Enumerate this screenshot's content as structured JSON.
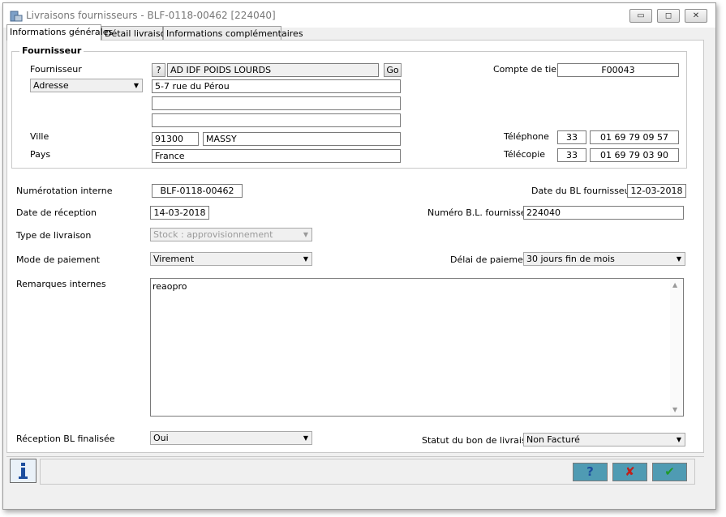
{
  "window": {
    "title": "Livraisons fournisseurs - BLF-0118-00462 [224040]",
    "controls": {
      "minimize": "▭",
      "maximize": "◻",
      "close": "✕"
    }
  },
  "tabs": [
    {
      "label": "Informations générales",
      "active": true
    },
    {
      "label": "Détail livraison",
      "active": false
    },
    {
      "label": "Informations complémentaires",
      "active": false
    }
  ],
  "supplier_group": {
    "title": "Fournisseur",
    "fournisseur_label": "Fournisseur",
    "lookup_button": "?",
    "fournisseur_value": "AD IDF POIDS LOURDS",
    "go_button": "Go",
    "adresse_select": "Adresse",
    "adresse_line1": "5-7 rue du Pérou",
    "adresse_line2": "",
    "adresse_line3": "",
    "ville_label": "Ville",
    "code_postal": "91300",
    "ville": "MASSY",
    "pays_label": "Pays",
    "pays": "France",
    "compte_tiers_label": "Compte de tiers",
    "compte_tiers": "F00043",
    "telephone_label": "Téléphone",
    "telephone_prefix": "33",
    "telephone": "01 69 79 09 57",
    "telecopie_label": "Télécopie",
    "telecopie_prefix": "33",
    "telecopie": "01 69 79 03 90"
  },
  "form": {
    "numerotation_label": "Numérotation interne",
    "numerotation": "BLF-0118-00462",
    "date_bl_label": "Date du BL fournisseur",
    "date_bl": "12-03-2018",
    "date_reception_label": "Date de réception",
    "date_reception": "14-03-2018",
    "numero_bl_label": "Numéro B.L. fournisseur",
    "numero_bl": "224040",
    "type_livraison_label": "Type de livraison",
    "type_livraison": "Stock : approvisionnement",
    "mode_paiement_label": "Mode de paiement",
    "mode_paiement": "Virement",
    "delai_paiement_label": "Délai de paiement",
    "delai_paiement": "30 jours fin de mois",
    "remarques_label": "Remarques internes",
    "remarques": "reaopro",
    "reception_finalisee_label": "Réception BL finalisée",
    "reception_finalisee": "Oui",
    "statut_label": "Statut du bon de livraison",
    "statut": "Non Facturé"
  },
  "footer": {
    "info_icon": "i",
    "help_button": "?",
    "cancel_button": "✘",
    "ok_button": "✔"
  },
  "colors": {
    "action_button": "#4f9bb3",
    "cancel_icon": "#c0201a",
    "ok_icon": "#1f9a2a",
    "help_icon": "#1d4e9e"
  }
}
